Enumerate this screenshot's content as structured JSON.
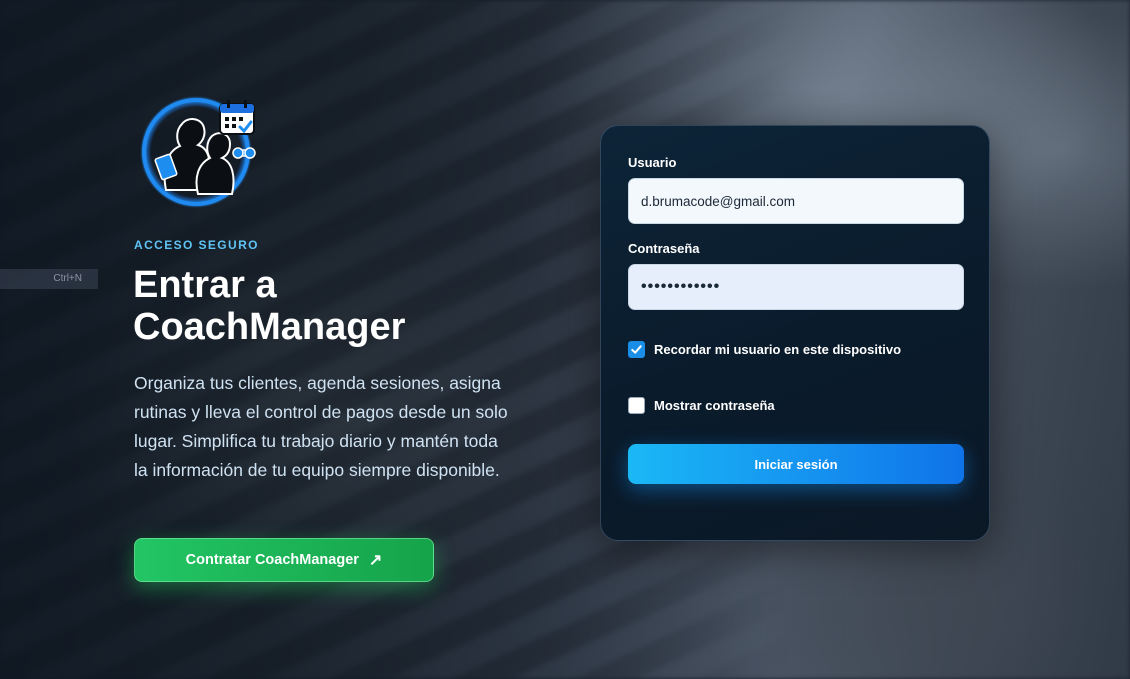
{
  "app": {
    "logo_icon": "coach-athletes-calendar-icon",
    "shortcut_hint": "Ctrl+N"
  },
  "hero": {
    "eyebrow": "ACCESO SEGURO",
    "title": "Entrar a CoachManager",
    "description": "Organiza tus clientes, agenda sesiones, asigna rutinas y lleva el control de pagos desde un solo lugar. Simplifica tu trabajo diario y mantén toda la información de tu equipo siempre disponible.",
    "cta_label": "Contratar CoachManager",
    "cta_icon": "arrow-up-right-icon",
    "cta_arrow": "↗"
  },
  "login": {
    "username_label": "Usuario",
    "username_value": "d.brumacode@gmail.com",
    "password_label": "Contraseña",
    "password_masked": "••••••••••••",
    "remember_label": "Recordar mi usuario en este dispositivo",
    "remember_checked": true,
    "show_password_label": "Mostrar contraseña",
    "show_password_checked": false,
    "submit_label": "Iniciar sesión"
  },
  "colors": {
    "accent_blue": "#1592f0",
    "cta_green": "#22c564",
    "eyebrow": "#5fc4f5",
    "card_bg": "#0d2438"
  }
}
